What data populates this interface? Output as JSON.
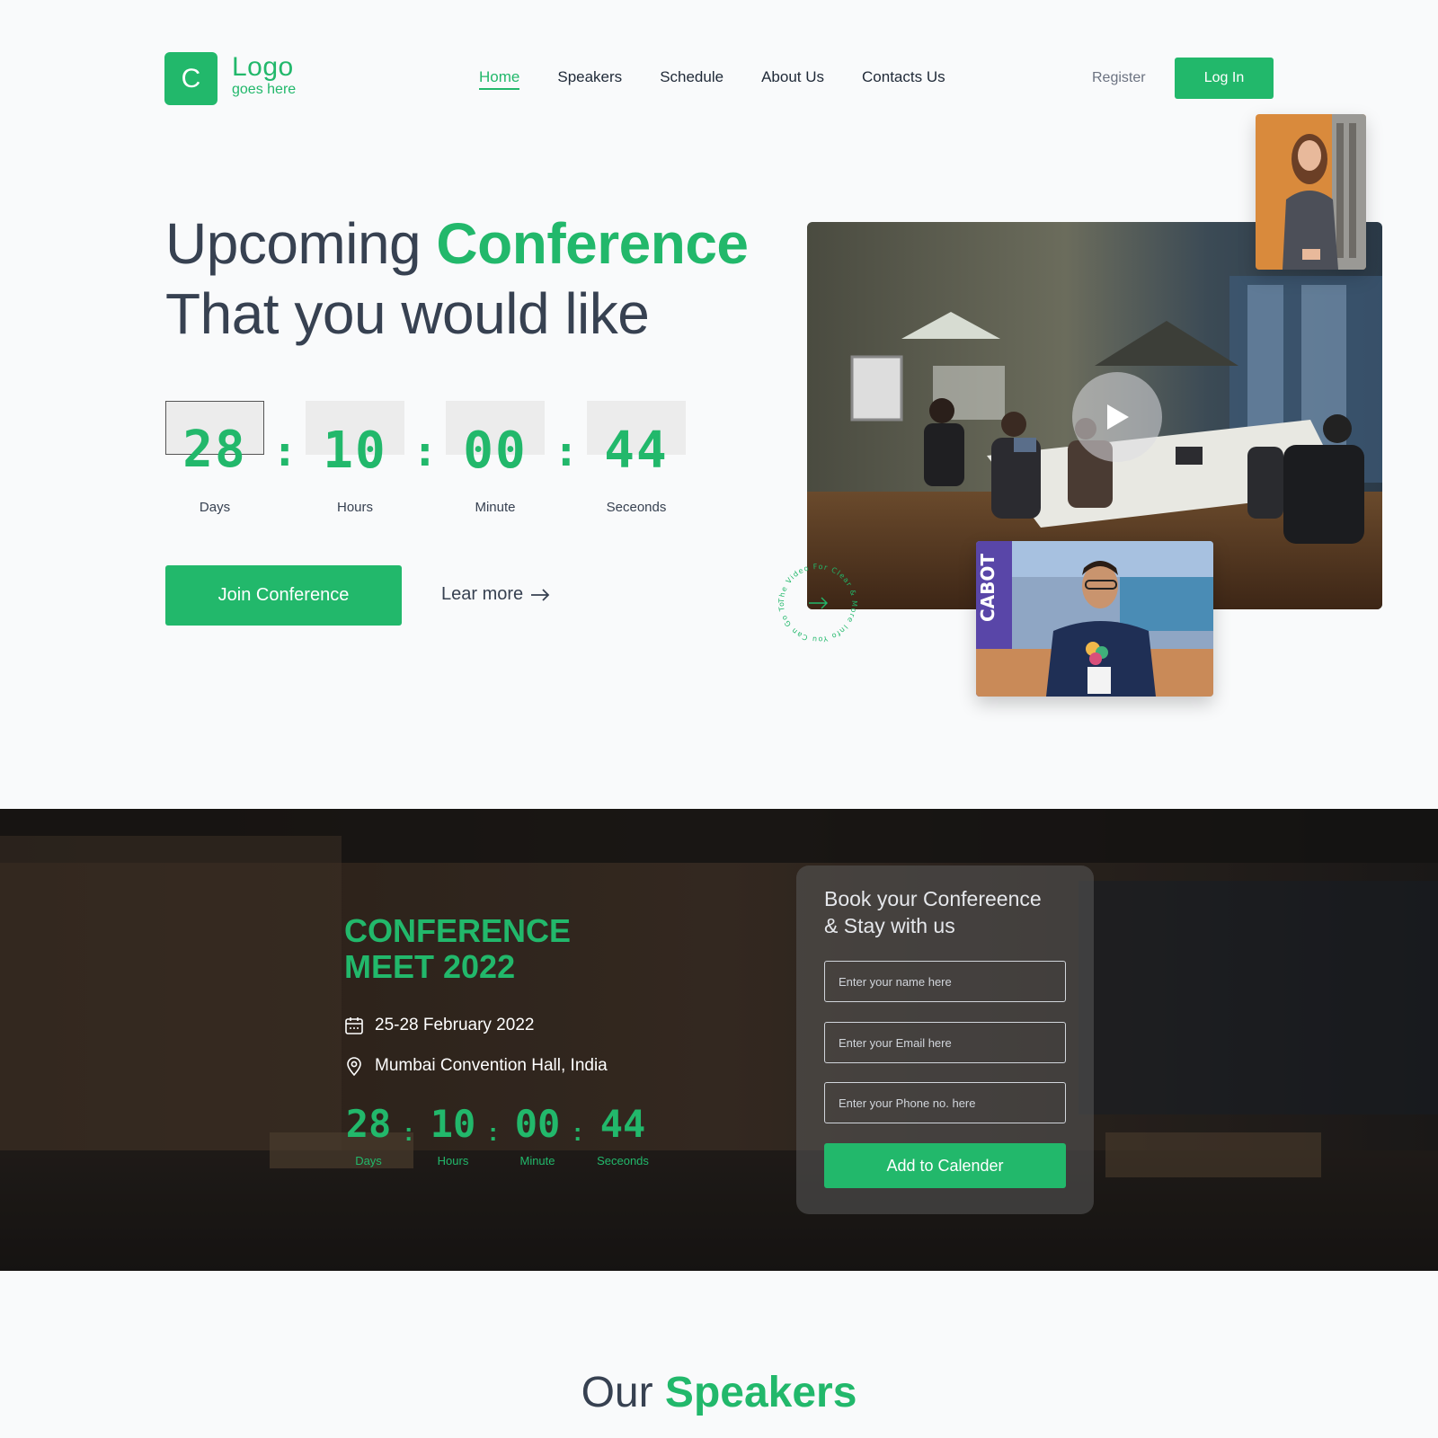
{
  "header": {
    "logo_letter": "C",
    "logo_main": "Logo",
    "logo_sub": "goes here",
    "nav": [
      "Home",
      "Speakers",
      "Schedule",
      "About Us",
      "Contacts Us"
    ],
    "register": "Register",
    "login": "Log In"
  },
  "hero": {
    "title_part1": "Upcoming",
    "title_highlight": "Conference",
    "title_line2": "That you would like",
    "countdown": [
      {
        "value": "28",
        "label": "Days"
      },
      {
        "value": "10",
        "label": "Hours"
      },
      {
        "value": "00",
        "label": "Minute"
      },
      {
        "value": "44",
        "label": "Seceonds"
      }
    ],
    "join_button": "Join Conference",
    "learn_more": "Lear more",
    "circle_text": "The Video For Clear & More Info You Can Go To Watch"
  },
  "event": {
    "title": "CONFERENCE MEET 2022",
    "date": "25-28 February 2022",
    "location": "Mumbai Convention Hall, India",
    "countdown": [
      {
        "value": "28",
        "label": "Days"
      },
      {
        "value": "10",
        "label": "Hours"
      },
      {
        "value": "00",
        "label": "Minute"
      },
      {
        "value": "44",
        "label": "Seceonds"
      }
    ]
  },
  "booking": {
    "title_line1": "Book your Confereence",
    "title_line2": "& Stay with us",
    "name_placeholder": "Enter your name here",
    "email_placeholder": "Enter your Email here",
    "phone_placeholder": "Enter your Phone no. here",
    "button": "Add to Calender"
  },
  "speakers": {
    "title_part1": "Our",
    "title_highlight": "Speakers"
  },
  "colors": {
    "accent": "#22b86b",
    "dark_band": "#2f241e"
  }
}
